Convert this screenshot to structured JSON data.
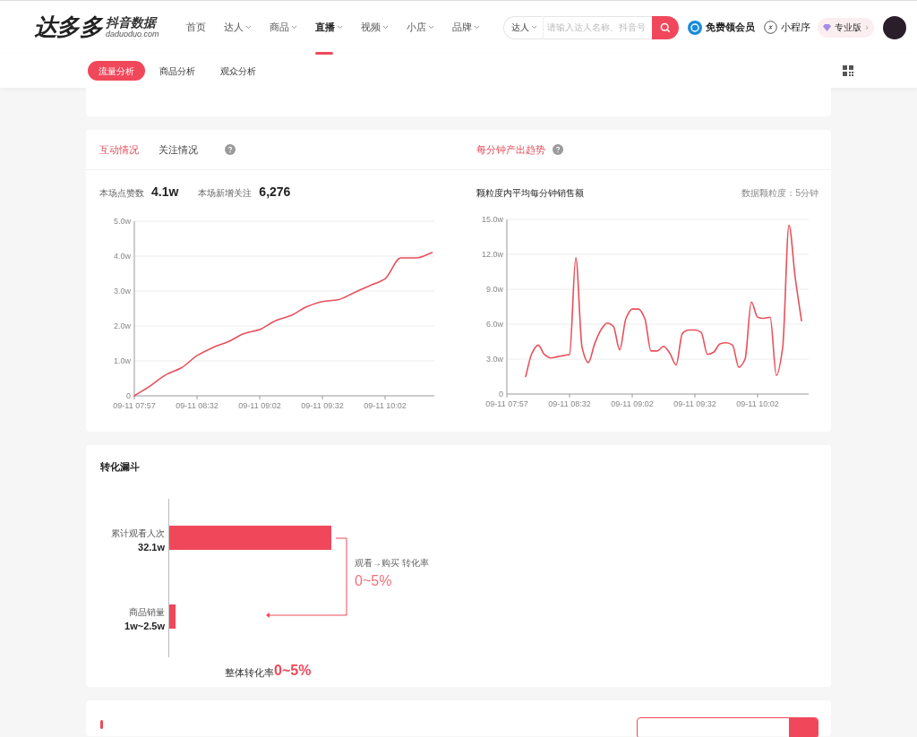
{
  "header": {
    "logo": "达多多",
    "logo_sub": "抖音数据",
    "logo_domain": "daduoduo.com",
    "nav": [
      {
        "label": "首页",
        "dropdown": false,
        "selected": false
      },
      {
        "label": "达人",
        "dropdown": true,
        "selected": false
      },
      {
        "label": "商品",
        "dropdown": true,
        "selected": false
      },
      {
        "label": "直播",
        "dropdown": true,
        "selected": true
      },
      {
        "label": "视频",
        "dropdown": true,
        "selected": false
      },
      {
        "label": "小店",
        "dropdown": true,
        "selected": false
      },
      {
        "label": "品牌",
        "dropdown": true,
        "selected": false
      }
    ],
    "search": {
      "scope": "达人",
      "placeholder": "请输入达人名称、抖音号"
    },
    "links": [
      "免费领会员",
      "小程序"
    ],
    "plan": "专业版",
    "plan_arrow": "›"
  },
  "subtabs": [
    {
      "label": "流量分析",
      "selected": true
    },
    {
      "label": "商品分析",
      "selected": false
    },
    {
      "label": "观众分析",
      "selected": false
    }
  ],
  "interaction": {
    "tabs": [
      {
        "label": "互动情况",
        "selected": true
      },
      {
        "label": "关注情况",
        "selected": false
      }
    ],
    "stats": [
      {
        "label": "本场点赞数",
        "value": "4.1w"
      },
      {
        "label": "本场新增关注",
        "value": "6,276"
      }
    ],
    "chart_data": {
      "type": "line",
      "categories": [
        "09-11 07:57",
        null,
        null,
        null,
        "09-11 08:32",
        null,
        null,
        null,
        "09-11 09:02",
        null,
        null,
        null,
        "09-11 09:32",
        null,
        null,
        null,
        "09-11 10:02",
        null,
        null,
        null
      ],
      "series": [
        {
          "color": "#e8505b",
          "values": [
            0,
            0.28,
            0.6,
            0.8,
            1.15,
            1.38,
            1.55,
            1.78,
            1.9,
            2.15,
            2.3,
            2.55,
            2.7,
            2.75,
            2.95,
            3.15,
            3.35,
            3.95,
            3.95,
            4.1
          ]
        }
      ],
      "ylim": [
        0,
        5
      ],
      "grid": true,
      "yticks": [
        {
          "value": 0,
          "label": "0"
        },
        {
          "value": 1,
          "label": "1.0w"
        },
        {
          "value": 2,
          "label": "2.0w"
        },
        {
          "value": 3,
          "label": "3.0w"
        },
        {
          "value": 4,
          "label": "4.0w"
        },
        {
          "value": 5,
          "label": "5.0w"
        }
      ]
    }
  },
  "trend": {
    "title": "每分钟产出趋势",
    "subtitle": "颗粒度内平均每分钟销售额",
    "granularity": "数据颗粒度：5分钟",
    "chart_data": {
      "type": "line",
      "categories": [
        "09-11 07:57",
        null,
        null,
        null,
        null,
        null,
        null,
        null,
        null,
        null,
        "09-11 08:32",
        null,
        null,
        null,
        null,
        null,
        null,
        null,
        null,
        null,
        "09-11 09:02",
        null,
        null,
        null,
        null,
        null,
        null,
        null,
        null,
        null,
        "09-11 09:32",
        null,
        null,
        null,
        null,
        null,
        null,
        null,
        null,
        null,
        "09-11 10:02",
        null,
        null,
        null,
        null,
        null,
        null,
        null
      ],
      "series": [
        {
          "color": "#e8505b",
          "values": [
            null,
            null,
            null,
            1.5,
            3.5,
            4.2,
            3.4,
            3.1,
            3.2,
            3.3,
            3.4,
            11.7,
            4.0,
            2.7,
            4.3,
            5.5,
            6.1,
            5.8,
            3.8,
            6.5,
            7.3,
            7.3,
            6.5,
            3.7,
            3.7,
            4.1,
            3.5,
            2.5,
            5.2,
            5.5,
            5.5,
            5.3,
            3.4,
            3.6,
            4.3,
            4.4,
            4.2,
            2.3,
            3.0,
            7.9,
            6.6,
            6.5,
            6.6,
            1.6,
            4.0,
            14.5,
            10.0,
            6.3
          ]
        }
      ],
      "ylim": [
        0,
        15
      ],
      "grid": true,
      "yticks": [
        {
          "value": 0,
          "label": "0"
        },
        {
          "value": 3,
          "label": "3.0w"
        },
        {
          "value": 6,
          "label": "6.0w"
        },
        {
          "value": 9,
          "label": "9.0w"
        },
        {
          "value": 12,
          "label": "12.0w"
        },
        {
          "value": 15,
          "label": "15.0w"
        }
      ]
    }
  },
  "funnel": {
    "title": "转化漏斗",
    "stages": [
      {
        "label": "累计观看人次",
        "value": "32.1w"
      },
      {
        "label": "商品销量",
        "value": "1w~2.5w"
      }
    ],
    "step": {
      "label": "观看→购买 转化率",
      "rate": "0~5%"
    },
    "overall": {
      "label": "整体转化率",
      "rate": "0~5%"
    }
  }
}
